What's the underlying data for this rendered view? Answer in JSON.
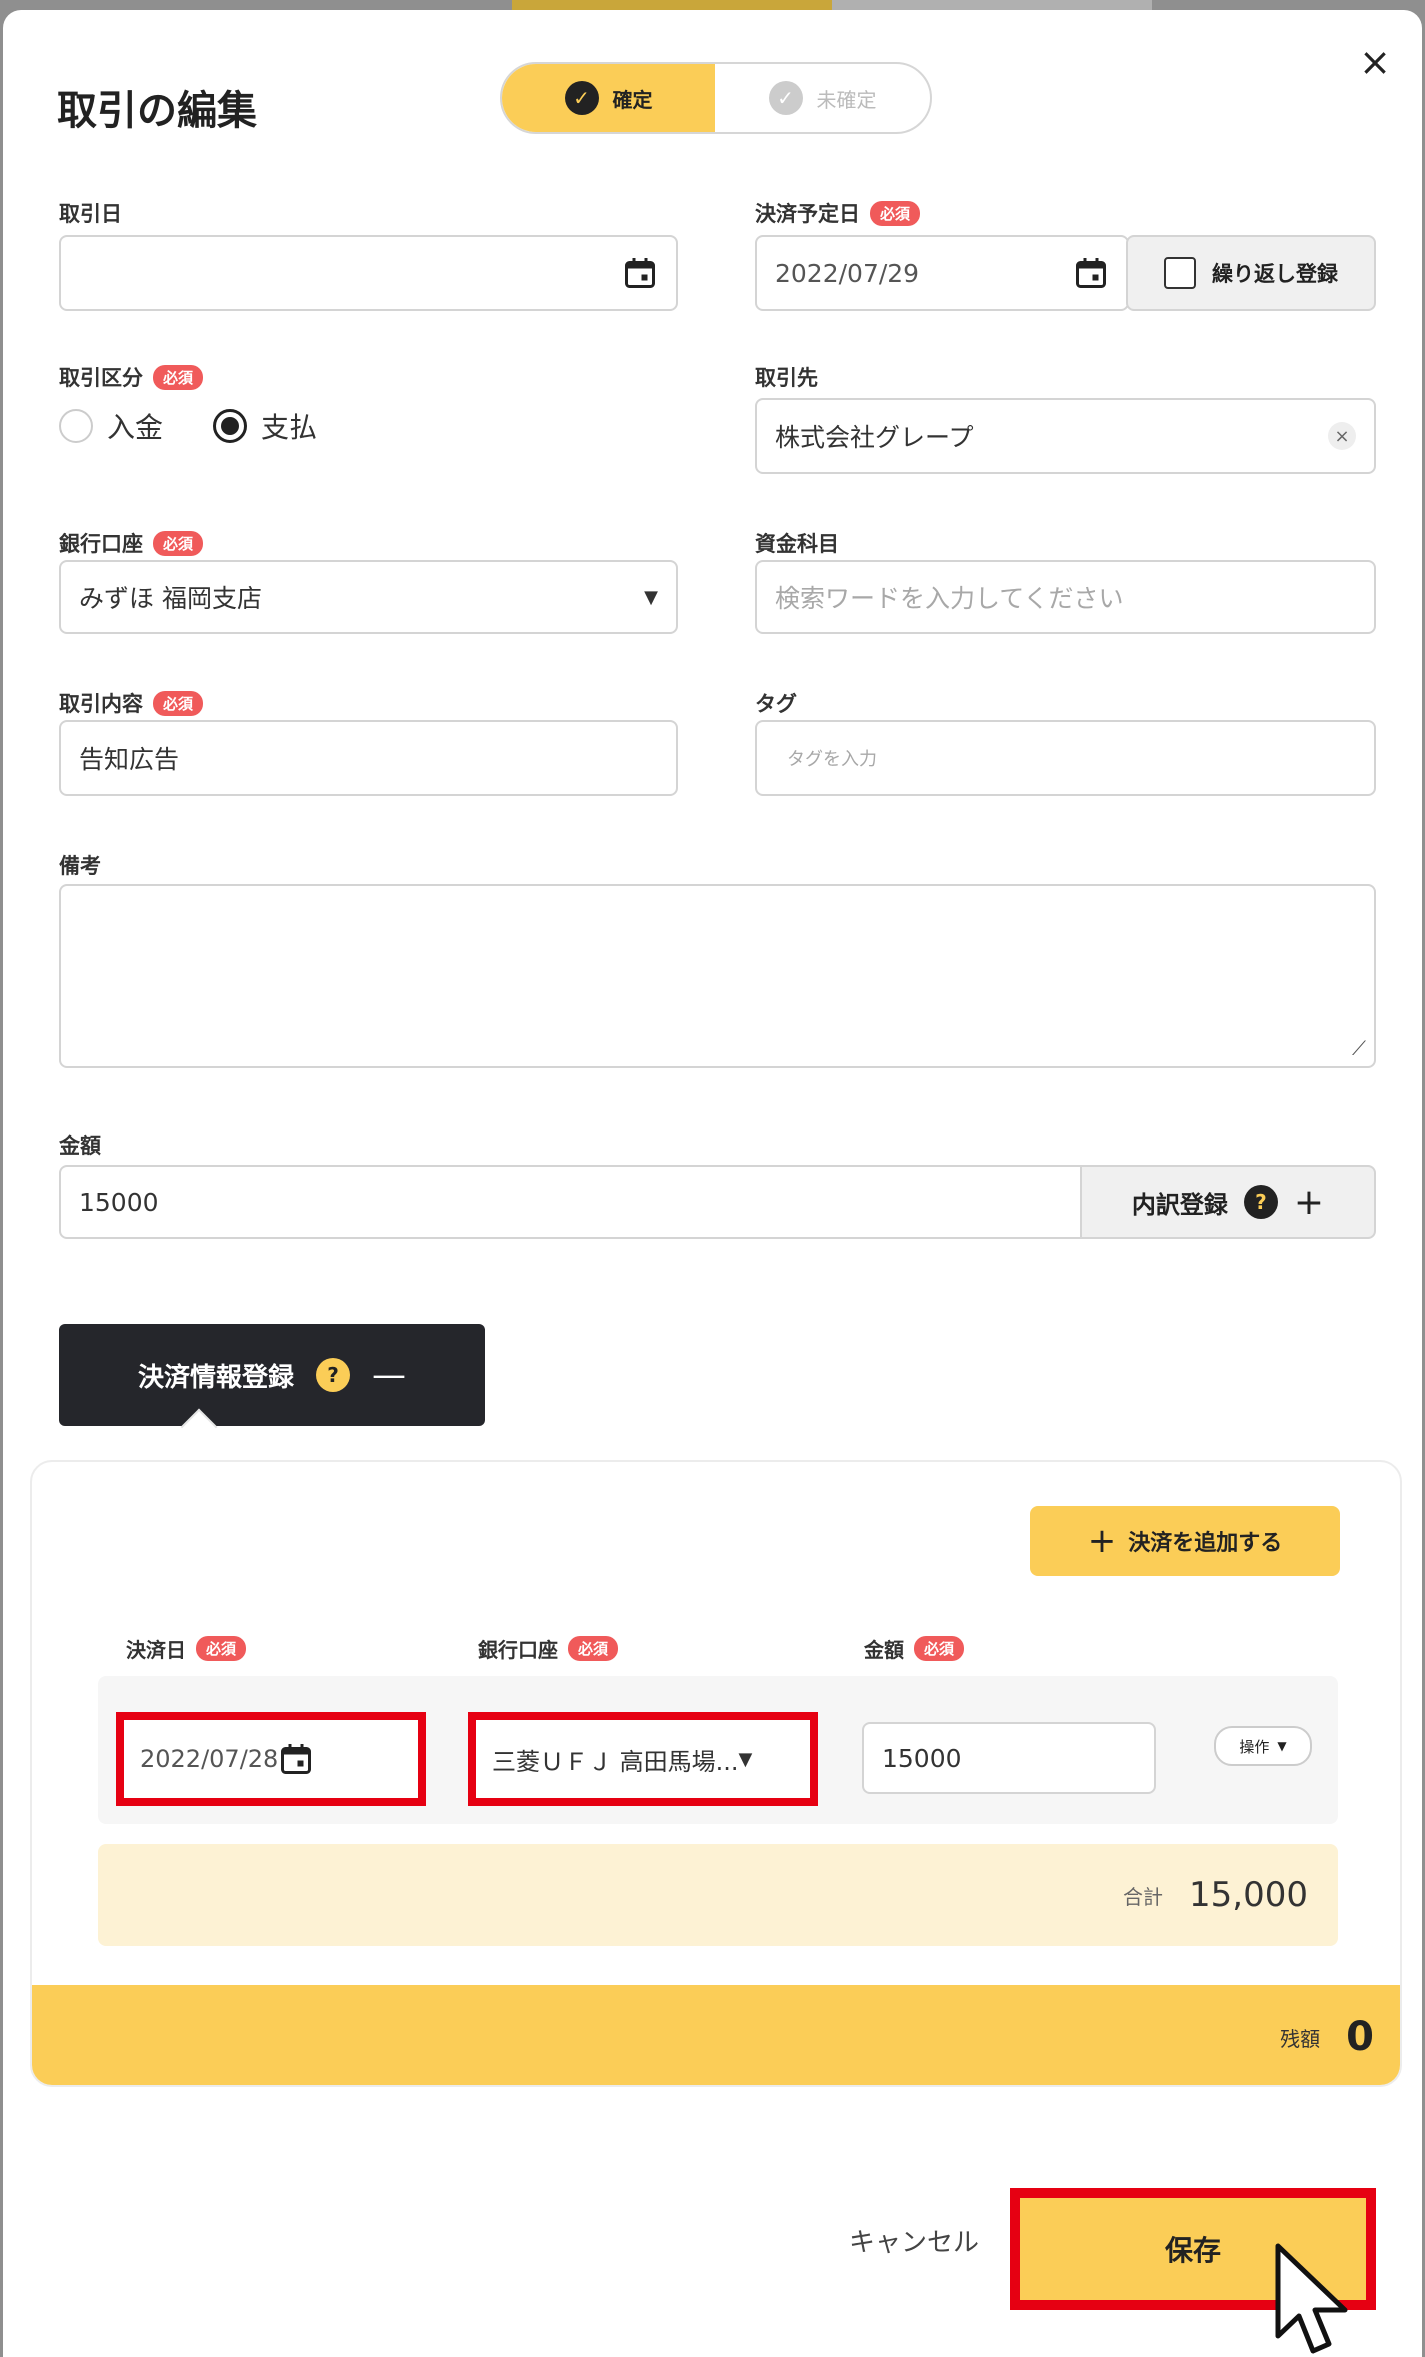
{
  "modal": {
    "title": "取引の編集",
    "close_glyph": "×"
  },
  "status_toggle": {
    "confirmed_label": "確定",
    "unconfirmed_label": "未確定",
    "selected": "確定"
  },
  "required_badge": "必須",
  "fields": {
    "transaction_date": {
      "label": "取引日",
      "value": ""
    },
    "scheduled_settlement_date": {
      "label": "決済予定日",
      "value": "2022/07/29"
    },
    "repeat_registration": {
      "label": "繰り返し登録",
      "checked": false
    },
    "transaction_type": {
      "label": "取引区分",
      "options": [
        "入金",
        "支払"
      ],
      "selected": "支払"
    },
    "counterparty": {
      "label": "取引先",
      "value": "株式会社グレープ"
    },
    "bank_account": {
      "label": "銀行口座",
      "value": "みずほ 福岡支店"
    },
    "fund_item": {
      "label": "資金科目",
      "placeholder": "検索ワードを入力してください"
    },
    "transaction_content": {
      "label": "取引内容",
      "value": "告知広告"
    },
    "tag": {
      "label": "タグ",
      "placeholder": "タグを入力"
    },
    "memo": {
      "label": "備考",
      "value": ""
    },
    "amount": {
      "label": "金額",
      "value": "15000"
    },
    "breakdown_label": "内訳登録"
  },
  "settlement": {
    "toggle_label": "決済情報登録",
    "add_label": "決済を追加する",
    "col_date": "決済日",
    "col_account": "銀行口座",
    "col_amount": "金額",
    "rows": [
      {
        "date": "2022/07/28",
        "account": "三菱ＵＦＪ 高田馬場...",
        "amount": "15000",
        "op_label": "操作"
      }
    ],
    "total_label": "合計",
    "total_value": "15,000",
    "remaining_label": "残額",
    "remaining_value": "0"
  },
  "footer": {
    "cancel_label": "キャンセル",
    "save_label": "保存"
  },
  "colors": {
    "accent": "#fbcd57",
    "required": "#f05a5a",
    "highlight": "#e60012",
    "dark_button": "#25262b"
  }
}
